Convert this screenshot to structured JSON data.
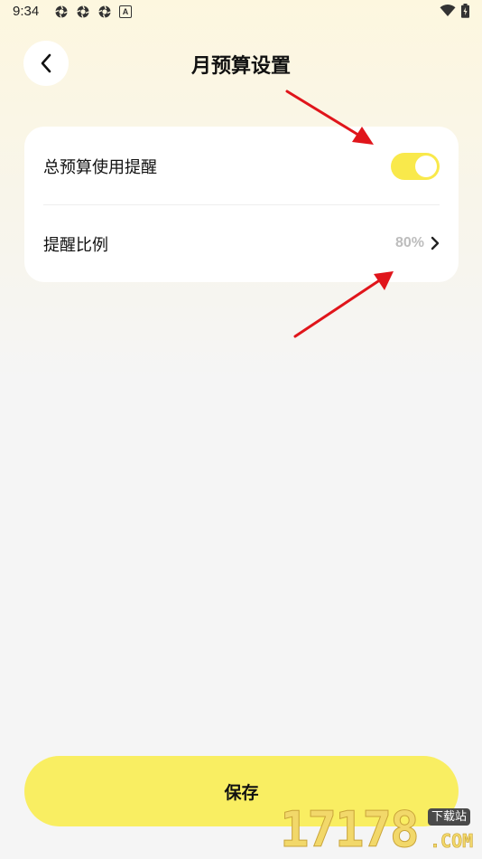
{
  "status_bar": {
    "time": "9:34",
    "left_icons": [
      "settings-gear-icon",
      "settings-gear-icon",
      "settings-gear-icon",
      "a-badge-icon"
    ],
    "a_badge": "A",
    "right_icons": [
      "wifi-icon",
      "battery-icon"
    ]
  },
  "header": {
    "title": "月预算设置",
    "back_icon": "chevron-left-icon"
  },
  "settings": {
    "reminder_label": "总预算使用提醒",
    "reminder_enabled": true,
    "ratio_label": "提醒比例",
    "ratio_value": "80%",
    "ratio_icon": "chevron-right-icon"
  },
  "save_label": "保存",
  "watermark": {
    "digits": "17178",
    "tag": "下载站",
    "com": ".COM"
  },
  "colors": {
    "accent_yellow": "#f9e94b",
    "save_button": "#f9ee62",
    "annotation_red": "#e0151b",
    "muted_text": "#bdbdbd"
  }
}
